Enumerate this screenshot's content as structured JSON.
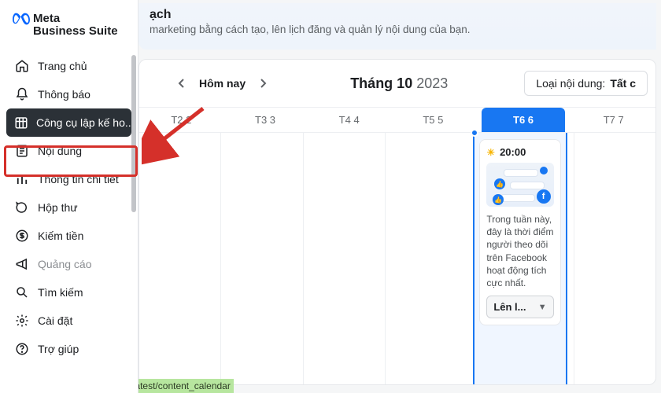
{
  "brand": {
    "line1": "Meta",
    "line2": "Business Suite"
  },
  "sidebar": {
    "items": [
      {
        "label": "Trang chủ"
      },
      {
        "label": "Thông báo"
      },
      {
        "label": "Công cụ lập kế ho..."
      },
      {
        "label": "Nội dung"
      },
      {
        "label": "Thông tin chi tiết"
      },
      {
        "label": "Hộp thư"
      },
      {
        "label": "Kiếm tiền"
      },
      {
        "label": "Quảng cáo"
      },
      {
        "label": "Tìm kiếm"
      },
      {
        "label": "Cài đặt"
      },
      {
        "label": "Trợ giúp"
      }
    ]
  },
  "header": {
    "title_fragment": "ạch",
    "subtitle": "marketing bằng cách tạo, lên lịch đăng và quản lý nội dung của bạn."
  },
  "calendar": {
    "today_label": "Hôm nay",
    "month": "Tháng 10",
    "year": "2023",
    "filter_prefix": "Loại nội dung: ",
    "filter_bold": "Tất c",
    "days": [
      {
        "label": "T2 2"
      },
      {
        "label": "T3 3"
      },
      {
        "label": "T4 4"
      },
      {
        "label": "T5 5"
      },
      {
        "label": "T6 6"
      },
      {
        "label": "T7 7"
      }
    ],
    "active_index": 4,
    "event": {
      "time": "20:00",
      "text": "Trong tuần này, đây là thời điểm người theo dõi trên Facebook hoạt động tích cực nhất.",
      "button": "Lên l..."
    }
  },
  "footer_url": "https://business.facebook.com/latest/content_calendar"
}
